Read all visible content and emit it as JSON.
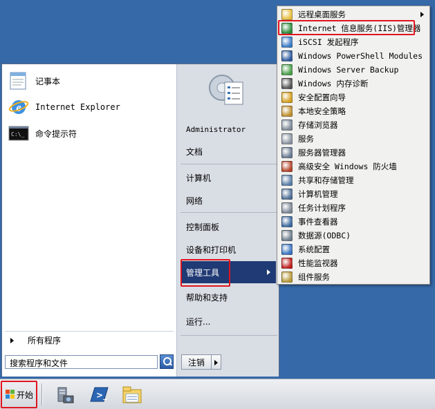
{
  "start_menu": {
    "pinned": [
      {
        "label": "记事本",
        "icon": "notepad-icon"
      },
      {
        "label": "Internet Explorer",
        "icon": "ie-icon"
      },
      {
        "label": "命令提示符",
        "icon": "cmd-icon"
      }
    ],
    "all_programs": "所有程序",
    "search_placeholder": "搜索程序和文件",
    "right_items": [
      {
        "label": "Administrator"
      },
      {
        "label": "文档"
      },
      {
        "label": "计算机"
      },
      {
        "label": "网络"
      },
      {
        "label": "控制面板"
      },
      {
        "label": "设备和打印机"
      },
      {
        "label": "管理工具"
      },
      {
        "label": "帮助和支持"
      },
      {
        "label": "运行..."
      }
    ],
    "shutdown_label": "注销"
  },
  "submenu": {
    "items": [
      {
        "label": "远程桌面服务",
        "icon": "folder-icon",
        "color": "#e8c040"
      },
      {
        "label": "Internet 信息服务(IIS)管理器",
        "icon": "iis-icon",
        "color": "#2f8d3d"
      },
      {
        "label": "iSCSI 发起程序",
        "icon": "iscsi-icon",
        "color": "#3a7cc8"
      },
      {
        "label": "Windows PowerShell Modules",
        "icon": "powershell-icon",
        "color": "#2f5b9c"
      },
      {
        "label": "Windows Server Backup",
        "icon": "backup-icon",
        "color": "#4aa04a"
      },
      {
        "label": "Windows 内存诊断",
        "icon": "memory-icon",
        "color": "#555555"
      },
      {
        "label": "安全配置向导",
        "icon": "security-wizard-icon",
        "color": "#d6a020"
      },
      {
        "label": "本地安全策略",
        "icon": "local-policy-icon",
        "color": "#c09030"
      },
      {
        "label": "存储浏览器",
        "icon": "storage-icon",
        "color": "#7f8b9a"
      },
      {
        "label": "服务",
        "icon": "services-icon",
        "color": "#8c96a3"
      },
      {
        "label": "服务器管理器",
        "icon": "server-manager-icon",
        "color": "#6b7b92"
      },
      {
        "label": "高级安全 Windows 防火墙",
        "icon": "firewall-icon",
        "color": "#b5452b"
      },
      {
        "label": "共享和存储管理",
        "icon": "share-icon",
        "color": "#5b7ea8"
      },
      {
        "label": "计算机管理",
        "icon": "computer-management-icon",
        "color": "#4f6f96"
      },
      {
        "label": "任务计划程序",
        "icon": "task-scheduler-icon",
        "color": "#7d8796"
      },
      {
        "label": "事件查看器",
        "icon": "event-viewer-icon",
        "color": "#3d6aa0"
      },
      {
        "label": "数据源(ODBC)",
        "icon": "odbc-icon",
        "color": "#6f7f8e"
      },
      {
        "label": "系统配置",
        "icon": "system-config-icon",
        "color": "#3b74c0"
      },
      {
        "label": "性能监视器",
        "icon": "performance-icon",
        "color": "#c02020"
      },
      {
        "label": "组件服务",
        "icon": "component-services-icon",
        "color": "#b89a3a"
      }
    ]
  },
  "taskbar": {
    "start_label": "开始",
    "icons": [
      "server-manager-taskbar-icon",
      "powershell-taskbar-icon",
      "explorer-taskbar-icon"
    ]
  }
}
